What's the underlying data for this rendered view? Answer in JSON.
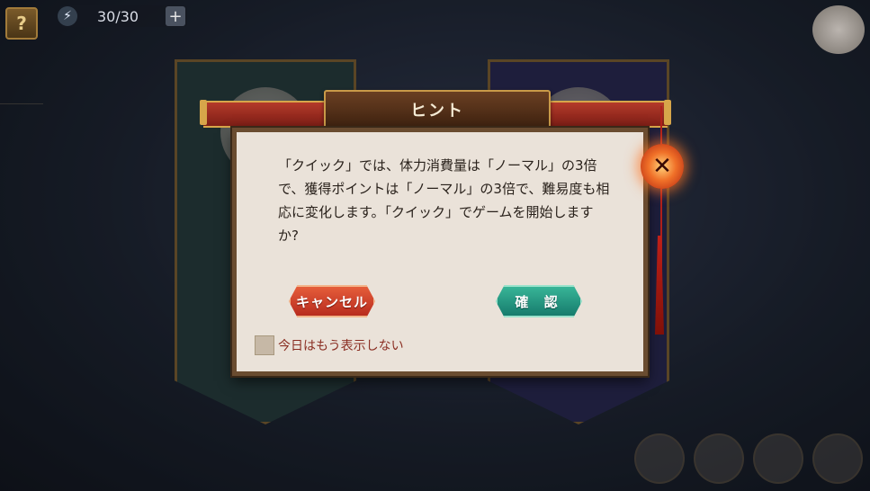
{
  "top_bar": {
    "help_icon": "?",
    "stamina_icon": "⚡",
    "stamina_value": "30/30",
    "plus_icon": "+"
  },
  "dialog": {
    "title": "ヒント",
    "message": "「クイック」では、体力消費量は「ノーマル」の3倍で、獲得ポイントは「ノーマル」の3倍で、難易度も相応に変化します。「クイック」でゲームを開始しますか?",
    "cancel_label": "キャンセル",
    "confirm_label": "確 認",
    "checkbox_label": "今日はもう表示しない",
    "checkbox_checked": false,
    "close_icon": "✕"
  },
  "colors": {
    "cancel": "#d0432a",
    "confirm": "#1f9a82",
    "title_bar": "#9a2a1e",
    "dialog_bg": "#eae2d9"
  }
}
